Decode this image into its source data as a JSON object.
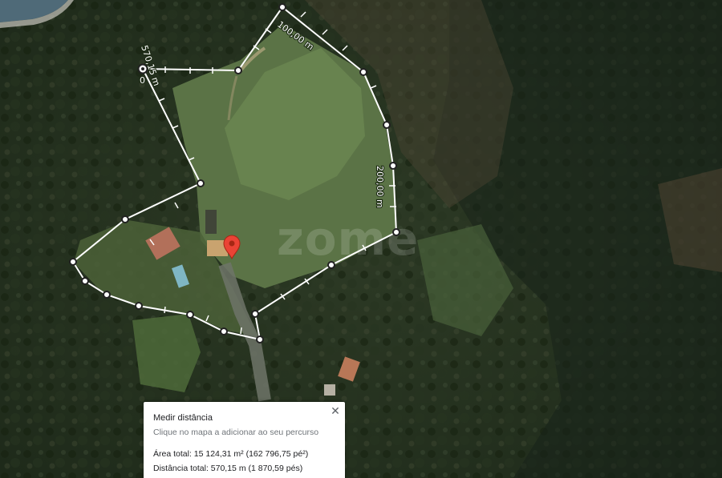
{
  "map": {
    "watermark": "zome",
    "labels": [
      "570,15 m",
      "100,00 m",
      "200,00 m"
    ],
    "start_marker": "0"
  },
  "panel": {
    "title": "Medir distância",
    "hint": "Clique no mapa a adicionar ao seu percurso",
    "area_total": "Área total: 15 124,31 m² (162 796,75 pé²)",
    "distance_total": "Distância total: 570,15 m (1 870,59 pés)",
    "close_icon": "close-icon"
  },
  "colors": {
    "path": "#ffffff",
    "pin": "#ea4335"
  }
}
